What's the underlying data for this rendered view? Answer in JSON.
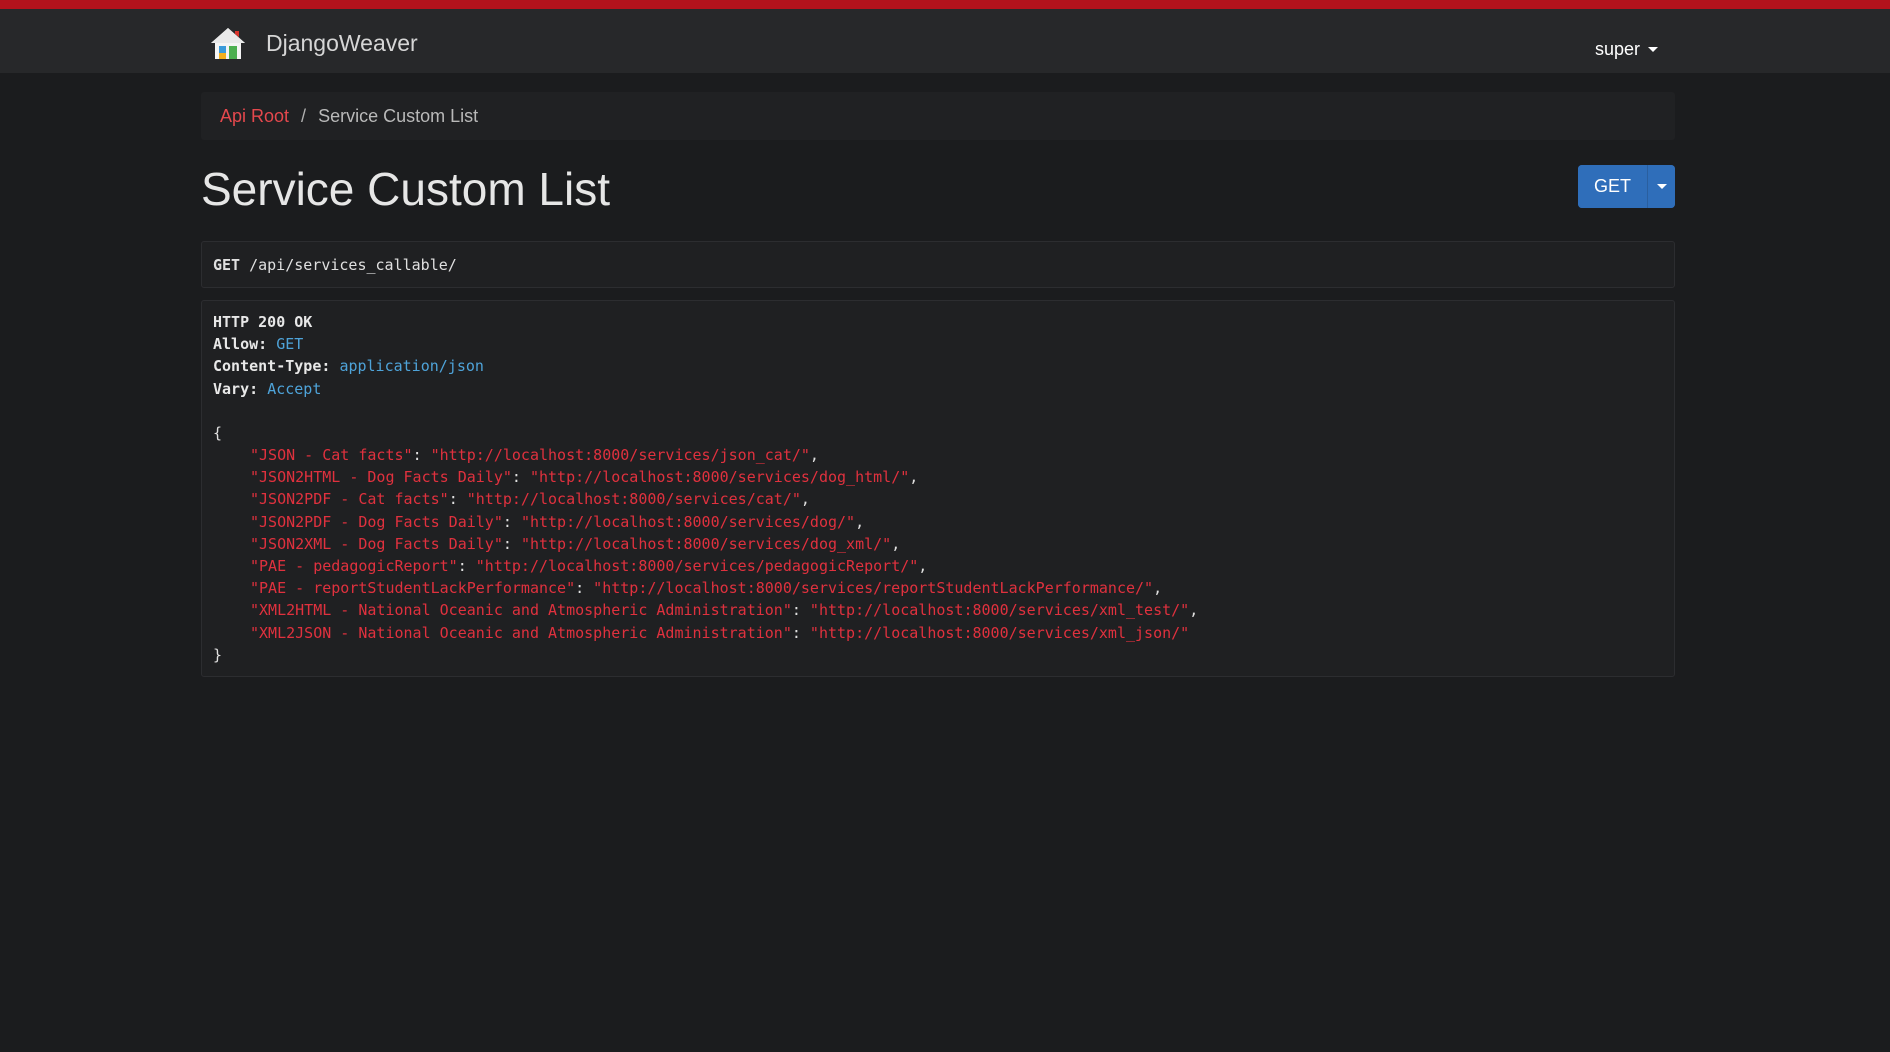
{
  "navbar": {
    "brand_name": "DjangoWeaver",
    "logo_icon": "house-icon",
    "user_label": "super"
  },
  "breadcrumb": {
    "root_label": "Api Root",
    "separator": "/",
    "current_label": "Service Custom List"
  },
  "page": {
    "title": "Service Custom List",
    "method_button": "GET"
  },
  "request": {
    "method": "GET",
    "path": "/api/services_callable/"
  },
  "response": {
    "status_line": "HTTP 200 OK",
    "headers": [
      {
        "key": "Allow:",
        "value": "GET"
      },
      {
        "key": "Content-Type:",
        "value": "application/json"
      },
      {
        "key": "Vary:",
        "value": "Accept"
      }
    ],
    "open_brace": "{",
    "close_brace": "}",
    "entries": [
      {
        "key": "\"JSON - Cat facts\"",
        "value": "\"http://localhost:8000/services/json_cat/\""
      },
      {
        "key": "\"JSON2HTML - Dog Facts Daily\"",
        "value": "\"http://localhost:8000/services/dog_html/\""
      },
      {
        "key": "\"JSON2PDF - Cat facts\"",
        "value": "\"http://localhost:8000/services/cat/\""
      },
      {
        "key": "\"JSON2PDF - Dog Facts Daily\"",
        "value": "\"http://localhost:8000/services/dog/\""
      },
      {
        "key": "\"JSON2XML - Dog Facts Daily\"",
        "value": "\"http://localhost:8000/services/dog_xml/\""
      },
      {
        "key": "\"PAE - pedagogicReport\"",
        "value": "\"http://localhost:8000/services/pedagogicReport/\""
      },
      {
        "key": "\"PAE - reportStudentLackPerformance\"",
        "value": "\"http://localhost:8000/services/reportStudentLackPerformance/\""
      },
      {
        "key": "\"XML2HTML - National Oceanic and Atmospheric Administration\"",
        "value": "\"http://localhost:8000/services/xml_test/\""
      },
      {
        "key": "\"XML2JSON - National Oceanic and Atmospheric Administration\"",
        "value": "\"http://localhost:8000/services/xml_json/\""
      }
    ]
  },
  "colors": {
    "accent_bar": "#b3121c",
    "link": "#e5484d",
    "button": "#2f6eba",
    "json_string": "#e0313e",
    "header_value": "#4ea3d9"
  }
}
